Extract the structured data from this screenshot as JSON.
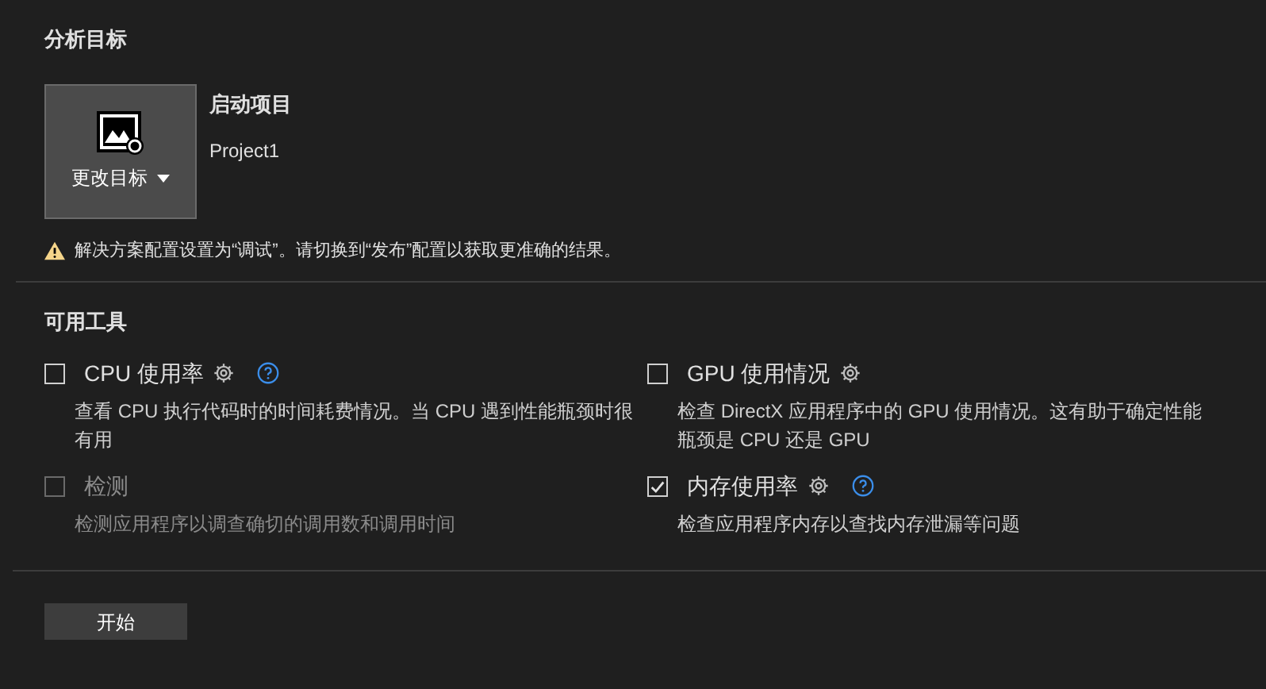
{
  "analysis_target": {
    "title": "分析目标",
    "change_button": {
      "label": "更改目标"
    },
    "project_heading": "启动项目",
    "project_name": "Project1",
    "warning": "解决方案配置设置为“调试”。请切换到“发布”配置以获取更准确的结果。"
  },
  "tools": {
    "title": "可用工具",
    "items": [
      {
        "name": "CPU 使用率",
        "description": "查看 CPU 执行代码时的时间耗费情况。当 CPU 遇到性能瓶颈时很有用",
        "checked": false,
        "disabled": false,
        "settings": true,
        "help": true
      },
      {
        "name": "GPU 使用情况",
        "description": "检查 DirectX 应用程序中的 GPU 使用情况。这有助于确定性能瓶颈是 CPU 还是 GPU",
        "checked": false,
        "disabled": false,
        "settings": true,
        "help": false
      },
      {
        "name": "检测",
        "description": "检测应用程序以调查确切的调用数和调用时间",
        "checked": false,
        "disabled": true,
        "settings": false,
        "help": false
      },
      {
        "name": "内存使用率",
        "description": "检查应用程序内存以查找内存泄漏等问题",
        "checked": true,
        "disabled": false,
        "settings": true,
        "help": true
      }
    ]
  },
  "start_button": {
    "label": "开始"
  }
}
